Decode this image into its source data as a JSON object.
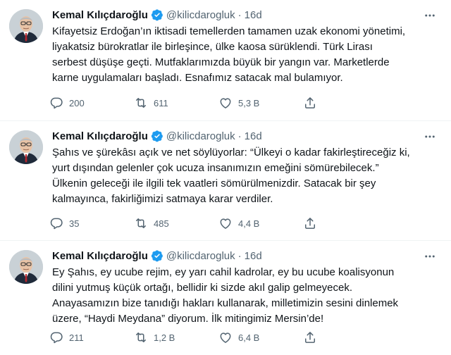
{
  "author": {
    "name": "Kemal Kılıçdaroğlu",
    "handle": "@kilicdarogluk"
  },
  "colors": {
    "verified": "#1d9bf0",
    "meta": "#536471",
    "text": "#0f1419"
  },
  "icons": {
    "reply": "reply-icon",
    "retweet": "retweet-icon",
    "like": "heart-icon",
    "share": "share-icon",
    "verified": "verified-badge-icon",
    "more": "more-icon"
  },
  "tweets": [
    {
      "time": "16d",
      "text": "Kifayetsiz Erdoğan’ın iktisadi temellerden tamamen uzak ekonomi yönetimi,\nliyakatsiz bürokratlar ile birleşince, ülke kaosa sürüklendi. Türk Lirası\nserbest düşüşe geçti. Mutfaklarımızda büyük bir yangın var. Marketlerde\nkarne uygulamaları başladı. Esnafımız satacak mal bulamıyor.",
      "replies": "200",
      "retweets": "611",
      "likes": "5,3 B"
    },
    {
      "time": "16d",
      "text": "Şahıs ve şürekâsı açık ve net söylüyorlar: “Ülkeyi o kadar fakirleştireceğiz ki,\nyurt dışından gelenler çok ucuza insanımızın emeğini sömürebilecek.”\nÜlkenin geleceği ile ilgili tek vaatleri sömürülmenizdir. Satacak bir şey\nkalmayınca, fakirliğimizi satmaya karar verdiler.",
      "replies": "35",
      "retweets": "485",
      "likes": "4,4 B"
    },
    {
      "time": "16d",
      "text": "Ey Şahıs, ey ucube rejim, ey yarı cahil kadrolar, ey bu ucube koalisyonun\ndilini yutmuş küçük ortağı, bellidir ki sizde akıl galip gelmeyecek.\nAnayasamızın bize tanıdığı hakları kullanarak, milletimizin sesini dinlemek\nüzere, “Haydi Meydana” diyorum. İlk mitingimiz Mersin’de!",
      "replies": "211",
      "retweets": "1,2 B",
      "likes": "6,4 B"
    }
  ]
}
